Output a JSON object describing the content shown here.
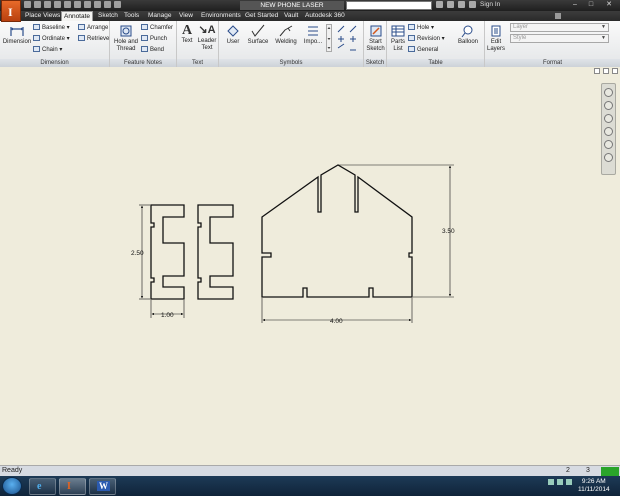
{
  "title_bar": {
    "document_title": "NEW PHONE LASER",
    "sign_in": "Sign In",
    "window_controls": {
      "minimize": "–",
      "maximize": "□",
      "close": "✕"
    },
    "app_icon": "inventor-logo-icon",
    "app_letter": "I"
  },
  "tabs": [
    {
      "label": "Place Views",
      "active": false
    },
    {
      "label": "Annotate",
      "active": true
    },
    {
      "label": "Sketch",
      "active": false
    },
    {
      "label": "Tools",
      "active": false
    },
    {
      "label": "Manage",
      "active": false
    },
    {
      "label": "View",
      "active": false
    },
    {
      "label": "Environments",
      "active": false
    },
    {
      "label": "Get Started",
      "active": false
    },
    {
      "label": "Vault",
      "active": false
    },
    {
      "label": "Autodesk 360",
      "active": false
    }
  ],
  "ribbon": {
    "dimension": {
      "group_label": "Dimension",
      "big": "Dimension",
      "baseline": "Baseline",
      "ordinate": "Ordinate",
      "chain": "Chain",
      "arrange": "Arrange",
      "retrieve": "Retrieve"
    },
    "feature_notes": {
      "group_label": "Feature Notes",
      "hole_and_thread_1": "Hole and",
      "hole_and_thread_2": "Thread",
      "chamfer": "Chamfer",
      "punch": "Punch",
      "bend": "Bend"
    },
    "text": {
      "group_label": "Text",
      "text": "Text",
      "leader_text_1": "Leader",
      "leader_text_2": "Text"
    },
    "symbols": {
      "group_label": "Symbols",
      "user": "User",
      "surface": "Surface",
      "welding": "Welding",
      "import": "Impo..."
    },
    "sketch": {
      "group_label": "Sketch",
      "start_sketch_1": "Start",
      "start_sketch_2": "Sketch"
    },
    "table": {
      "group_label": "Table",
      "parts_list_1": "Parts",
      "parts_list_2": "List",
      "hole": "Hole",
      "revision": "Revision",
      "general": "General"
    },
    "balloon": {
      "label": "Balloon"
    },
    "layers": {
      "edit_layers_1": "Edit",
      "edit_layers_2": "Layers"
    },
    "format": {
      "group_label": "Format",
      "layer_placeholder": "Layer",
      "style_placeholder": "Style"
    }
  },
  "drawing": {
    "dimensions": {
      "left_height": "2.50",
      "left_width": "1.00",
      "right_height": "3.50",
      "right_width": "4.00"
    }
  },
  "status_bar": {
    "text": "Ready",
    "count_1": "2",
    "count_2": "3"
  },
  "taskbar": {
    "time": "9:26 AM",
    "date": "11/11/2014",
    "apps": [
      "ie-icon",
      "inventor-icon",
      "word-icon"
    ],
    "word_letter": "W"
  },
  "colors": {
    "canvas": "#efecdc",
    "accent_orange": "#d4561a",
    "ribbon_label": "#cdd2d8",
    "status_green": "#2aa52a"
  }
}
